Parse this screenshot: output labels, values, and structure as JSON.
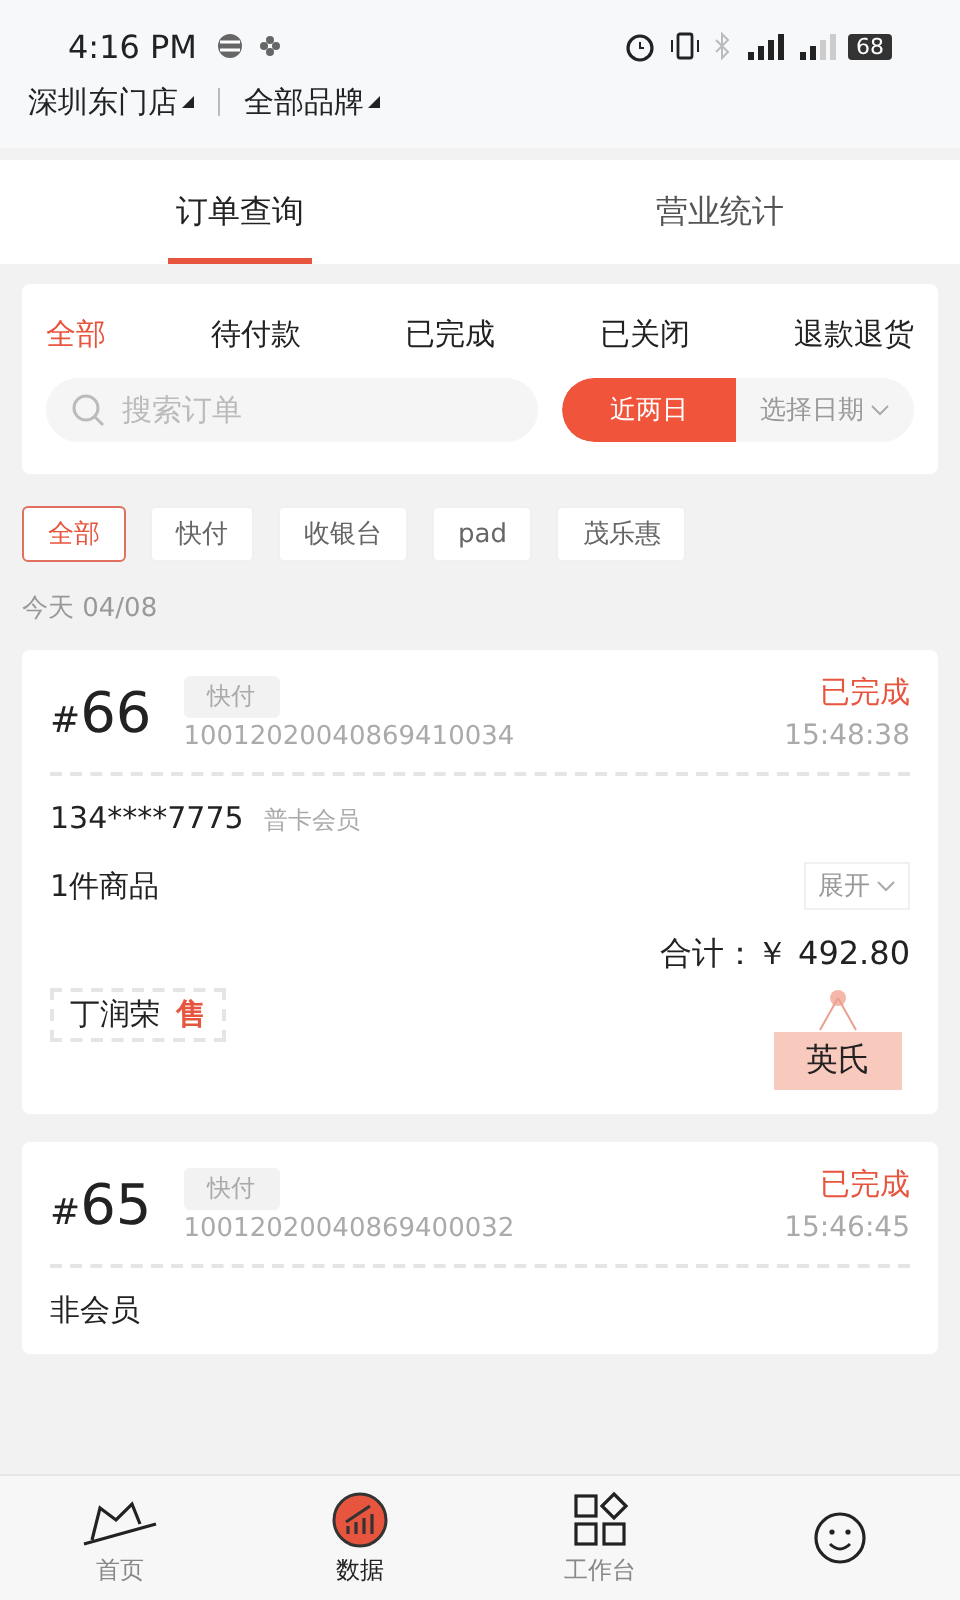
{
  "status_bar": {
    "time": "4:16 PM",
    "battery": "68"
  },
  "header": {
    "store": "深圳东门店",
    "brand": "全部品牌"
  },
  "tabs": [
    {
      "label": "订单查询",
      "selected": true
    },
    {
      "label": "营业统计",
      "selected": false
    }
  ],
  "status_filters": [
    {
      "label": "全部",
      "selected": true
    },
    {
      "label": "待付款",
      "selected": false
    },
    {
      "label": "已完成",
      "selected": false
    },
    {
      "label": "已关闭",
      "selected": false
    },
    {
      "label": "退款退货",
      "selected": false
    }
  ],
  "search": {
    "placeholder": "搜索订单"
  },
  "date_filters": [
    {
      "label": "近两日",
      "selected": true
    },
    {
      "label": "选择日期",
      "selected": false
    }
  ],
  "channels": [
    {
      "label": "全部",
      "selected": true
    },
    {
      "label": "快付",
      "selected": false
    },
    {
      "label": "收银台",
      "selected": false
    },
    {
      "label": "pad",
      "selected": false
    },
    {
      "label": "茂乐惠",
      "selected": false
    }
  ],
  "date_heading": "今天  04/08",
  "orders": [
    {
      "hash": "#",
      "number": "66",
      "channel": "快付",
      "order_no": "10012020040869410034",
      "status": "已完成",
      "time": "15:48:38",
      "customer": "134****7775",
      "member_type": "普卡会员",
      "items": "1件商品",
      "expand": "展开",
      "total": "合计：￥ 492.80",
      "seller": "丁润荣",
      "seller_badge": "售",
      "tag": "英氏"
    },
    {
      "hash": "#",
      "number": "65",
      "channel": "快付",
      "order_no": "10012020040869400032",
      "status": "已完成",
      "time": "15:46:45",
      "customer": "非会员"
    }
  ],
  "nav": [
    {
      "label": "首页",
      "kind": "home",
      "selected": false
    },
    {
      "label": "数据",
      "kind": "data",
      "selected": true
    },
    {
      "label": "工作台",
      "kind": "workbench",
      "selected": false
    },
    {
      "kind": "me",
      "selected": false
    }
  ]
}
